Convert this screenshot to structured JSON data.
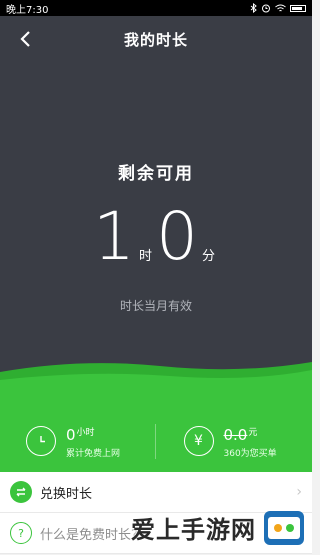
{
  "status_bar": {
    "time": "晚上7:30",
    "right_icons": [
      "bluetooth-icon",
      "alarm-icon",
      "wifi-icon",
      "battery-icon"
    ]
  },
  "nav": {
    "title": "我的时长"
  },
  "hero": {
    "remaining_label": "剩余可用",
    "hours": "1",
    "hours_unit": "时",
    "minutes": "0",
    "minutes_unit": "分",
    "validity": "时长当月有效"
  },
  "stats": {
    "left": {
      "value": "0",
      "unit": "小时",
      "label": "累计免费上网"
    },
    "right": {
      "value": "0.0",
      "unit": "元",
      "label": "360为您买单"
    }
  },
  "list": [
    {
      "label": "兑换时长"
    },
    {
      "label": "什么是免费时长?"
    }
  ],
  "watermark": {
    "text": "爱上手游网"
  },
  "colors": {
    "hero_bg": "#3a3d45",
    "accent_green": "#3bc43d"
  }
}
